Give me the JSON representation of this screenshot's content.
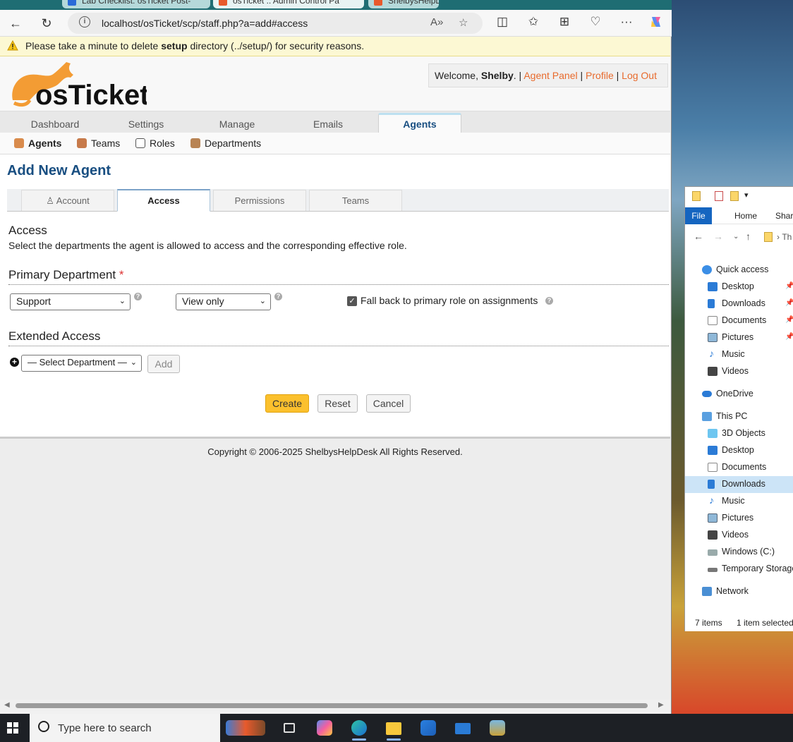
{
  "browser": {
    "tabs": [
      {
        "label": "Lab Checklist: osTicket Post-"
      },
      {
        "label": "osTicket :: Admin Control Pa"
      },
      {
        "label": "ShelbysHelpD"
      }
    ],
    "url": "localhost/osTicket/scp/staff.php?a=add#access"
  },
  "warning": {
    "prefix": "Please take a minute to delete ",
    "bold": "setup",
    "suffix": " directory (../setup/) for security reasons."
  },
  "header": {
    "logo_text": "osTicket",
    "welcome_prefix": "Welcome, ",
    "user": "Shelby",
    "welcome_suffix": ". |",
    "links": {
      "agent_panel": "Agent Panel",
      "profile": "Profile",
      "logout": "Log Out"
    },
    "sep": "|"
  },
  "nav": {
    "tabs": [
      "Dashboard",
      "Settings",
      "Manage",
      "Emails",
      "Agents"
    ],
    "active": "Agents"
  },
  "subnav": {
    "items": [
      "Agents",
      "Teams",
      "Roles",
      "Departments"
    ]
  },
  "main": {
    "title": "Add New Agent",
    "form_tabs": [
      "Account",
      "Access",
      "Permissions",
      "Teams"
    ],
    "section_title": "Access",
    "section_desc": "Select the departments the agent is allowed to access and the corresponding effective role.",
    "primary_dept_label": "Primary Department",
    "required_mark": "*",
    "dept_value": "Support",
    "role_value": "View only",
    "fallback_label": "Fall back to primary role on assignments",
    "fallback_checked": true,
    "extended_label": "Extended Access",
    "select_dept_placeholder": "— Select Department —",
    "add_label": "Add",
    "buttons": {
      "create": "Create",
      "reset": "Reset",
      "cancel": "Cancel"
    }
  },
  "footer": {
    "copyright": "Copyright © 2006-2025 ShelbysHelpDesk All Rights Reserved."
  },
  "explorer": {
    "ribbon": [
      "File",
      "Home",
      "Share"
    ],
    "path_fragment": "Th",
    "tree": [
      {
        "label": "Quick access",
        "icon": "star-icon"
      },
      {
        "label": "Desktop",
        "icon": "desktop-icon"
      },
      {
        "label": "Downloads",
        "icon": "download-icon"
      },
      {
        "label": "Documents",
        "icon": "document-icon"
      },
      {
        "label": "Pictures",
        "icon": "pictures-icon"
      },
      {
        "label": "Music",
        "icon": "music-icon"
      },
      {
        "label": "Videos",
        "icon": "videos-icon"
      },
      {
        "label": "OneDrive",
        "icon": "cloud-icon"
      },
      {
        "label": "This PC",
        "icon": "computer-icon"
      },
      {
        "label": "3D Objects",
        "icon": "cube-icon"
      },
      {
        "label": "Desktop",
        "icon": "desktop-icon"
      },
      {
        "label": "Documents",
        "icon": "document-icon"
      },
      {
        "label": "Downloads",
        "icon": "download-icon"
      },
      {
        "label": "Music",
        "icon": "music-icon"
      },
      {
        "label": "Pictures",
        "icon": "pictures-icon"
      },
      {
        "label": "Videos",
        "icon": "videos-icon"
      },
      {
        "label": "Windows (C:)",
        "icon": "drive-icon"
      },
      {
        "label": "Temporary Storage",
        "icon": "drive-icon"
      },
      {
        "label": "Network",
        "icon": "network-icon"
      }
    ],
    "status_items": "7 items",
    "status_selected": "1 item selected"
  },
  "taskbar": {
    "search_placeholder": "Type here to search"
  },
  "colors": {
    "brand_blue": "#184e81",
    "link_orange": "#e86a2c",
    "create_yellow": "#fbc02d",
    "warning_bg": "#fcf8d3"
  }
}
